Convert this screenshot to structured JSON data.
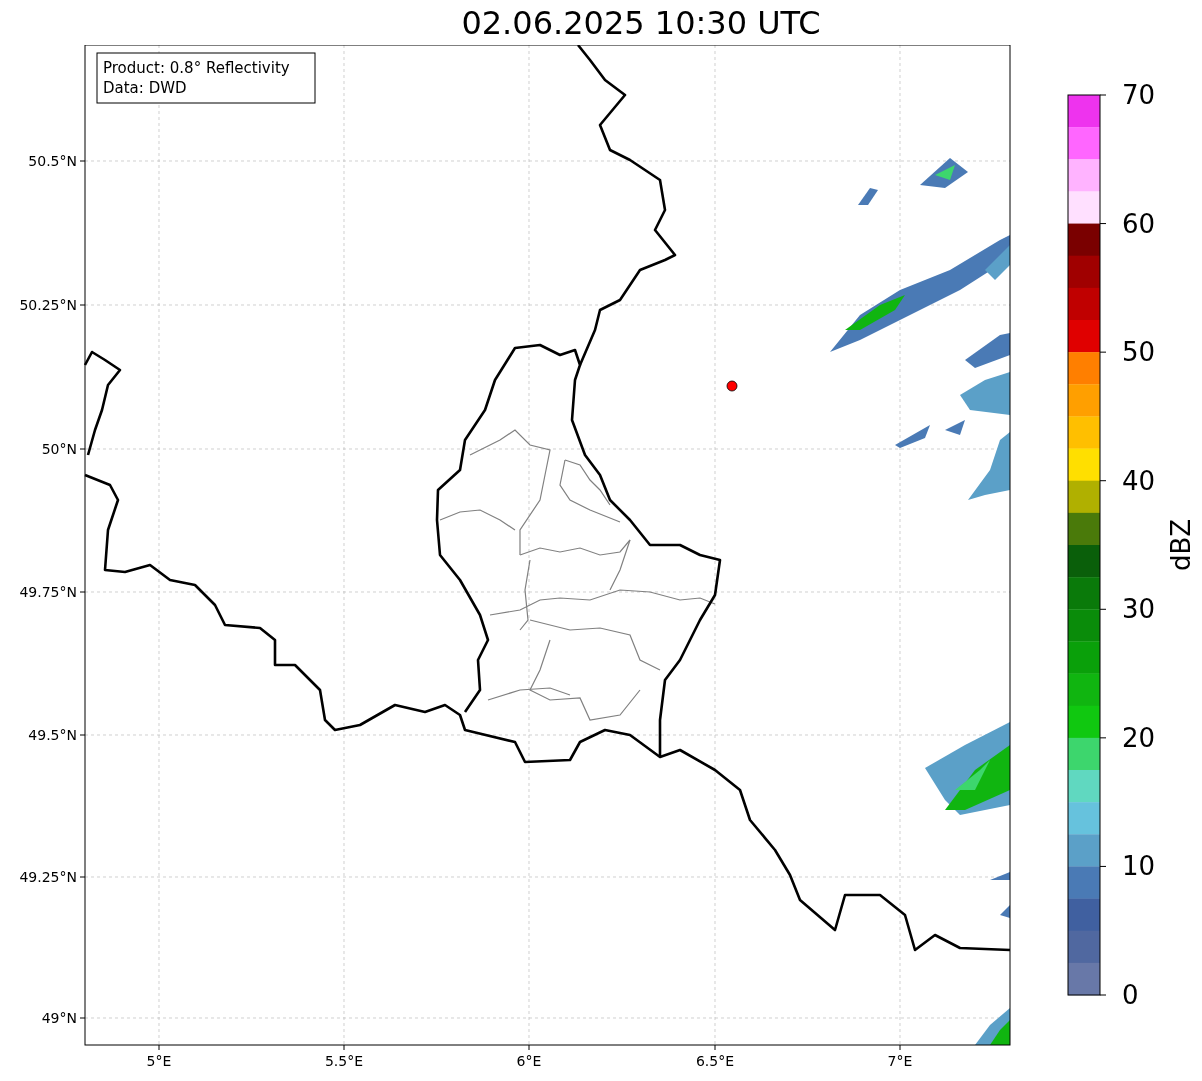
{
  "title": "02.06.2025 10:30 UTC",
  "map": {
    "info_box": [
      "Product: 0.8° Reflectivity",
      "Data: DWD"
    ],
    "xticks": [
      "5°E",
      "5.5°E",
      "6°E",
      "6.5°E",
      "7°E"
    ],
    "yticks": [
      "50.5°N",
      "50.25°N",
      "50°N",
      "49.75°N",
      "49.5°N",
      "49.25°N",
      "49°N"
    ]
  },
  "colorbar": {
    "label": "dBZ",
    "ticks": [
      "70",
      "60",
      "50",
      "40",
      "30",
      "20",
      "10",
      "0"
    ],
    "bands": [
      {
        "color": "#ee33ee"
      },
      {
        "color": "#ff66ff"
      },
      {
        "color": "#ffb3ff"
      },
      {
        "color": "#ffe0ff"
      },
      {
        "color": "#7a0000"
      },
      {
        "color": "#a00000"
      },
      {
        "color": "#c00000"
      },
      {
        "color": "#e00000"
      },
      {
        "color": "#ff7f00"
      },
      {
        "color": "#ff9f00"
      },
      {
        "color": "#ffbf00"
      },
      {
        "color": "#ffdf00"
      },
      {
        "color": "#b0b000"
      },
      {
        "color": "#4a7a0a"
      },
      {
        "color": "#0a5f0a"
      },
      {
        "color": "#0a7a0a"
      },
      {
        "color": "#0a8c0a"
      },
      {
        "color": "#0aa00a"
      },
      {
        "color": "#10b510"
      },
      {
        "color": "#10c810"
      },
      {
        "color": "#3dd66d"
      },
      {
        "color": "#60d8c0"
      },
      {
        "color": "#66c2dd"
      },
      {
        "color": "#5ba0c8"
      },
      {
        "color": "#4a7ab5"
      },
      {
        "color": "#4060a0"
      },
      {
        "color": "#5068a0"
      },
      {
        "color": "#6878a8"
      }
    ]
  }
}
